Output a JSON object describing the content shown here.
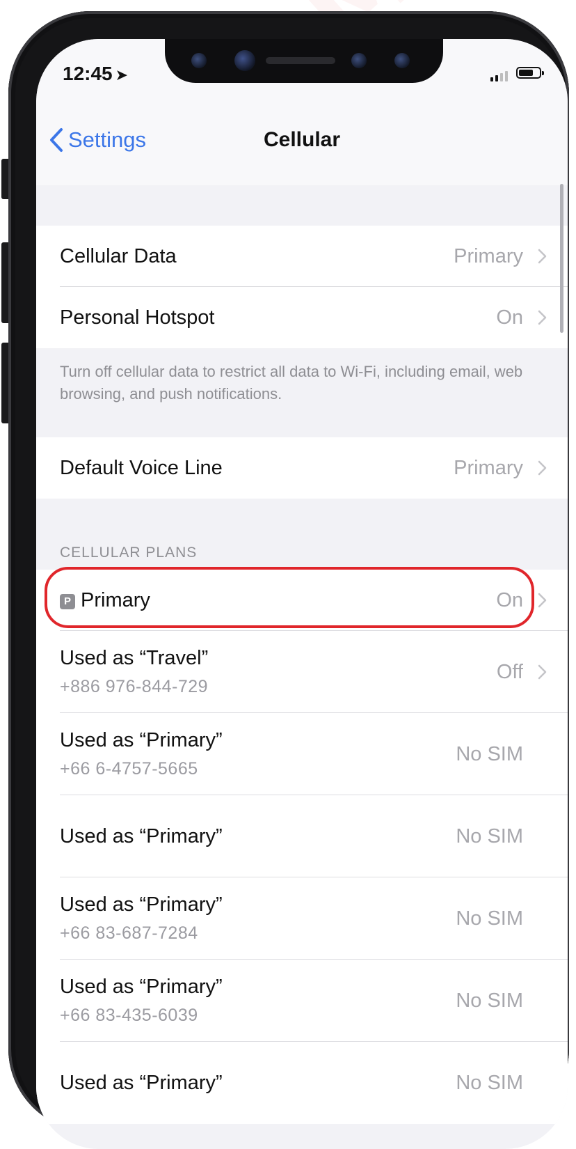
{
  "watermark": "SAMURAI SIM",
  "status_bar": {
    "time": "12:45",
    "location_icon": "location-arrow-icon",
    "battery_level": 0.7
  },
  "nav": {
    "back_label": "Settings",
    "title": "Cellular"
  },
  "group1": [
    {
      "label": "Cellular Data",
      "value": "Primary"
    },
    {
      "label": "Personal Hotspot",
      "value": "On"
    }
  ],
  "group1_footer": "Turn off cellular data to restrict all data to Wi-Fi, including email, web browsing, and push notifications.",
  "group2": [
    {
      "label": "Default Voice Line",
      "value": "Primary"
    }
  ],
  "plans_header": "CELLULAR PLANS",
  "plans": [
    {
      "badge": "P",
      "label": "Primary",
      "value": "On"
    },
    {
      "label": "Used as “Travel”",
      "number": "+886 976-844-729",
      "value": "Off"
    },
    {
      "label": "Used as “Primary”",
      "number": "+66 6-4757-5665",
      "value": "No SIM"
    },
    {
      "label": "Used as “Primary”",
      "value": "No SIM"
    },
    {
      "label": "Used as “Primary”",
      "number": "+66 83-687-7284",
      "value": "No SIM"
    },
    {
      "label": "Used as “Primary”",
      "number": "+66 83-435-6039",
      "value": "No SIM"
    },
    {
      "label": "Used as “Primary”",
      "value": "No SIM"
    }
  ],
  "colors": {
    "accent": "#3b76e8",
    "highlight": "#e0262b",
    "background": "#f2f2f6"
  }
}
